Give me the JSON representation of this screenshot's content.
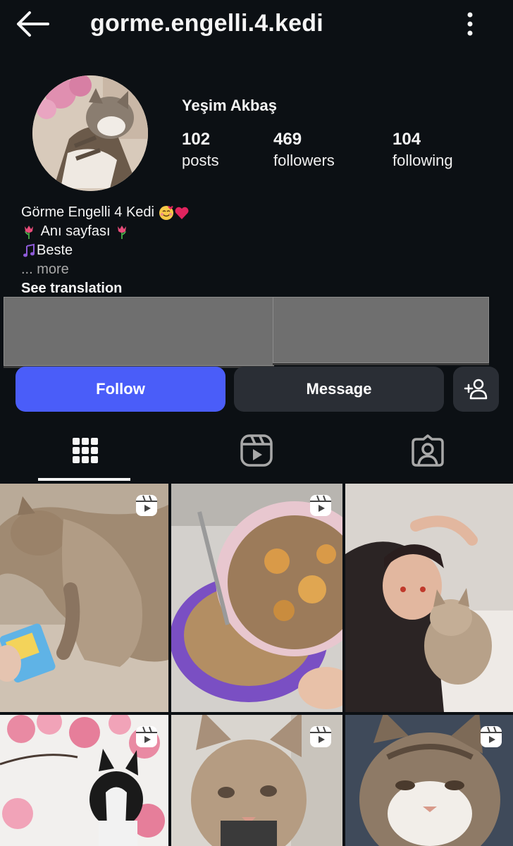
{
  "header": {
    "username": "gorme.engelli.4.kedi",
    "back_icon": "arrow-left-icon",
    "menu_icon": "vertical-dots-icon"
  },
  "profile": {
    "display_name": "Yeşim Akbaş",
    "stats": [
      {
        "value": "102",
        "label": "posts"
      },
      {
        "value": "469",
        "label": "followers"
      },
      {
        "value": "104",
        "label": "following"
      }
    ]
  },
  "bio": {
    "line1": "Görme Engelli 4 Kedi",
    "line2": "Anı sayfası",
    "line3": "Beste",
    "more": "... more",
    "see_translation": "See translation"
  },
  "actions": {
    "follow": "Follow",
    "message": "Message",
    "suggest_icon": "add-person-icon"
  },
  "tabs": [
    {
      "name": "posts-grid",
      "icon": "grid-icon",
      "active": true
    },
    {
      "name": "reels",
      "icon": "reels-icon",
      "active": false
    },
    {
      "name": "tagged",
      "icon": "tagged-person-icon",
      "active": false
    }
  ],
  "colors": {
    "background": "#0c1014",
    "follow_button": "#4a5df9",
    "secondary_button": "#2a2e35"
  }
}
